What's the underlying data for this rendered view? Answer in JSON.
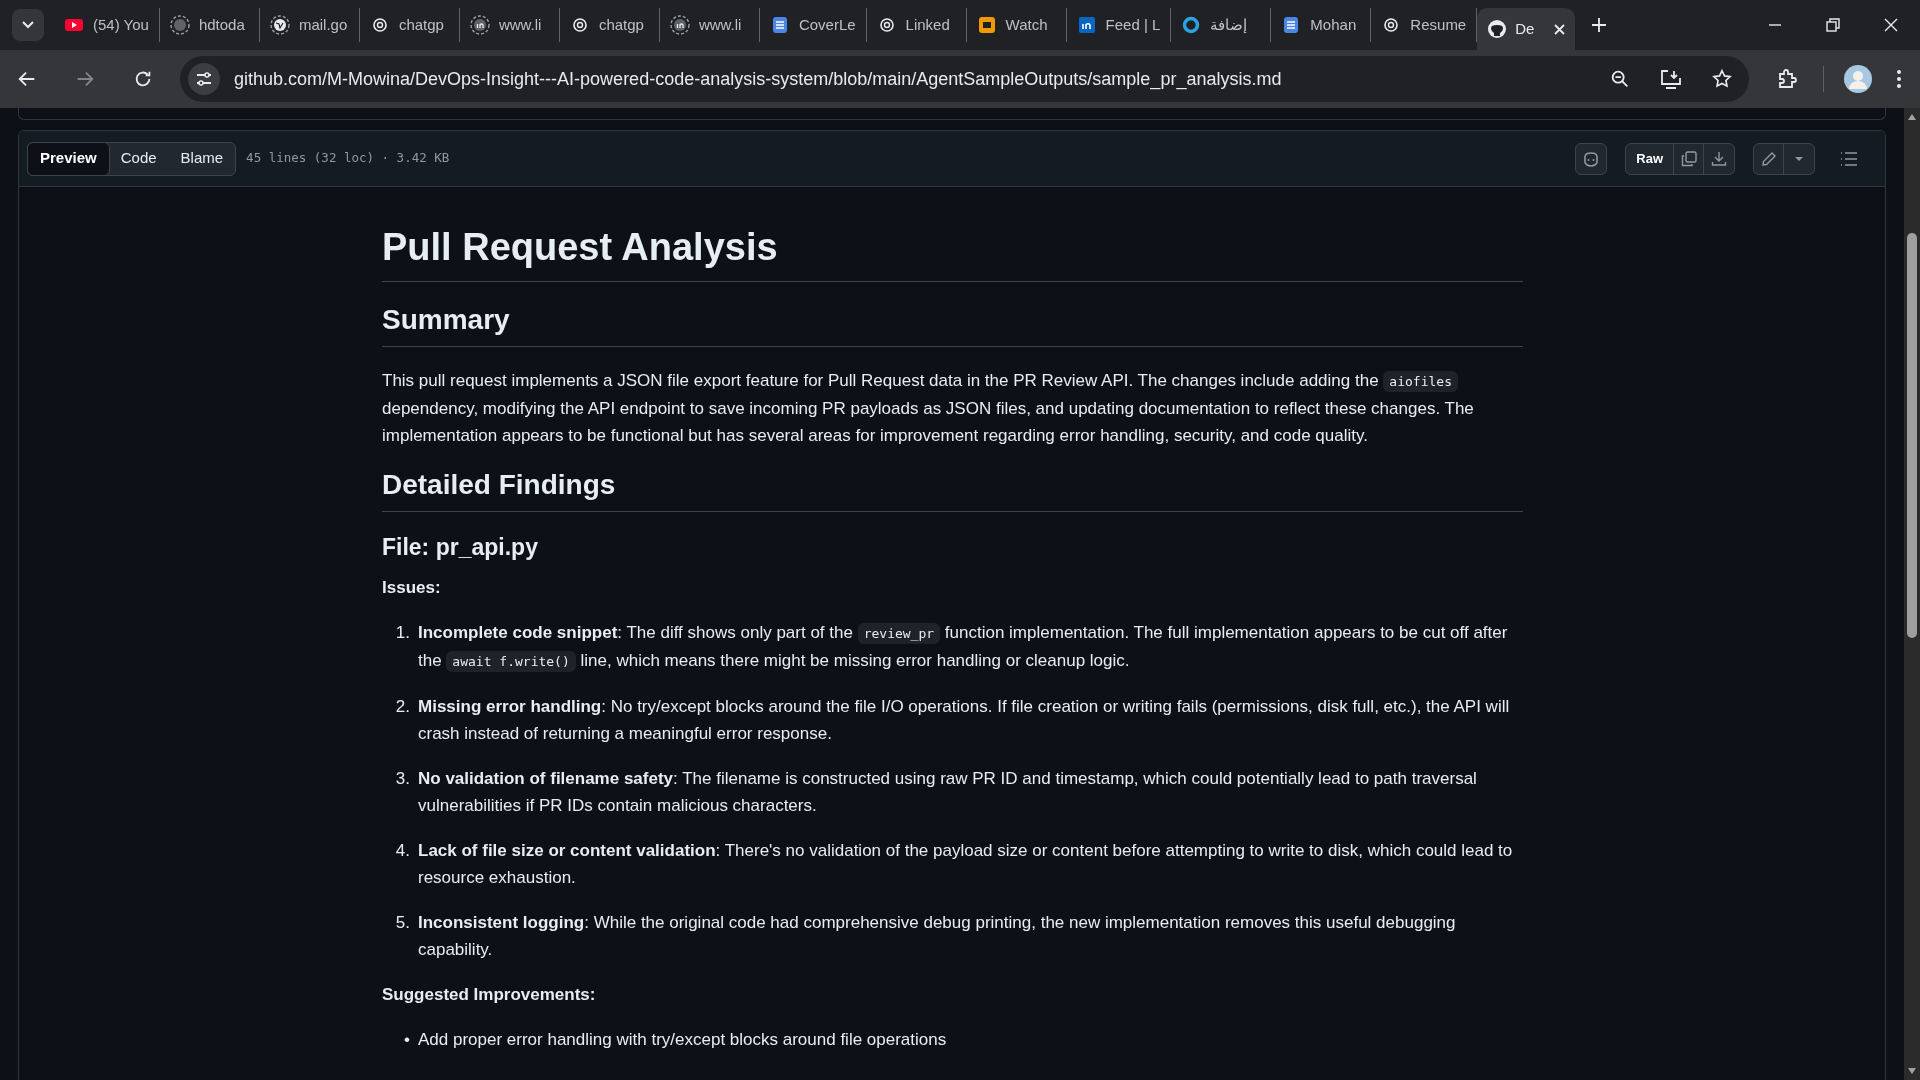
{
  "browser": {
    "tabs": [
      {
        "label": "(54) You",
        "selected": false
      },
      {
        "label": "hdtoda",
        "selected": false
      },
      {
        "label": "mail.go",
        "selected": false
      },
      {
        "label": "chatgp",
        "selected": false
      },
      {
        "label": "www.li",
        "selected": false
      },
      {
        "label": "chatgp",
        "selected": false
      },
      {
        "label": "www.li",
        "selected": false
      },
      {
        "label": "CoverLe",
        "selected": false
      },
      {
        "label": "Linked",
        "selected": false
      },
      {
        "label": "Watch",
        "selected": false
      },
      {
        "label": "Feed | L",
        "selected": false
      },
      {
        "label": "إضافة",
        "selected": false
      },
      {
        "label": "Mohan",
        "selected": false
      },
      {
        "label": "Resume",
        "selected": false
      },
      {
        "label": "De",
        "selected": true
      }
    ],
    "url": "github.com/M-Mowina/DevOps-Insight---AI-powered-code-analysis-system/blob/main/AgentSampleOutputs/sample_pr_analysis.md"
  },
  "file_header": {
    "view_tabs": [
      {
        "label": "Preview",
        "selected": true
      },
      {
        "label": "Code",
        "selected": false
      },
      {
        "label": "Blame",
        "selected": false
      }
    ],
    "info": "45 lines (32 loc) · 3.42 KB",
    "raw_button": "Raw"
  },
  "document": [
    {
      "kind": "h1",
      "text": "Pull Request Analysis"
    },
    {
      "kind": "h2",
      "text": "Summary"
    },
    {
      "kind": "p",
      "parts": [
        {
          "kind": "text",
          "text": "This pull request implements a JSON file export feature for Pull Request data in the PR Review API. The changes include adding the "
        },
        {
          "kind": "code",
          "text": "aiofiles"
        },
        {
          "kind": "text",
          "text": " dependency, modifying the API endpoint to save incoming PR payloads as JSON files, and updating documentation to reflect these changes. The implementation appears to be functional but has several areas for improvement regarding error handling, security, and code quality."
        }
      ]
    },
    {
      "kind": "h2",
      "text": "Detailed Findings"
    },
    {
      "kind": "h3",
      "text": "File: pr_api.py"
    },
    {
      "kind": "label",
      "text": "Issues:"
    },
    {
      "kind": "list",
      "items": [
        {
          "marker": "1.",
          "parts": [
            {
              "kind": "text",
              "text": "**Incomplete code snippet**: The diff shows only part of the "
            },
            {
              "kind": "code",
              "text": "review_pr"
            },
            {
              "kind": "text",
              "text": " function implementation. The full implementation appears to be cut off after the "
            },
            {
              "kind": "code",
              "text": "await f.write()"
            },
            {
              "kind": "text",
              "text": " line, which means there might be missing error handling or cleanup logic."
            }
          ]
        },
        {
          "marker": "2.",
          "parts": [
            {
              "kind": "text",
              "text": "**Missing error handling**: No try/except blocks around the file I/O operations. If file creation or writing fails (permissions, disk full, etc.), the API will crash instead of returning a meaningful error response."
            }
          ]
        },
        {
          "marker": "3.",
          "parts": [
            {
              "kind": "text",
              "text": "**No validation of filename safety**: The filename is constructed using raw PR ID and timestamp, which could potentially lead to path traversal vulnerabilities if PR IDs contain malicious characters."
            }
          ]
        },
        {
          "marker": "4.",
          "parts": [
            {
              "kind": "text",
              "text": "**Lack of file size or content validation**: There's no validation of the payload size or content before attempting to write to disk, which could lead to resource exhaustion."
            }
          ]
        },
        {
          "marker": "5.",
          "parts": [
            {
              "kind": "text",
              "text": "**Inconsistent logging**: While the original code had comprehensive debug printing, the new implementation removes this useful debugging capability."
            }
          ]
        }
      ]
    },
    {
      "kind": "label",
      "text": "Suggested Improvements:"
    },
    {
      "kind": "list",
      "items": [
        {
          "marker": "•",
          "parts": [
            {
              "kind": "text",
              "text": "Add proper error handling with try/except blocks around file operations"
            }
          ]
        }
      ]
    }
  ]
}
